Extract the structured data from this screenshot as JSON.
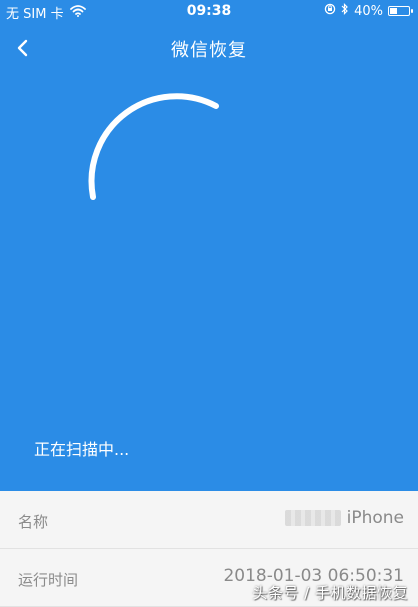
{
  "status_bar": {
    "carrier": "无 SIM 卡",
    "time": "09:38",
    "battery_text": "40%",
    "battery_level": 0.4
  },
  "nav": {
    "title": "微信恢复"
  },
  "scan": {
    "status_text": "正在扫描中..."
  },
  "info": {
    "rows": [
      {
        "label": "名称",
        "value": "iPhone"
      },
      {
        "label": "运行时间",
        "value": "2018-01-03 06:50:31"
      }
    ]
  },
  "watermark": "头条号 / 手机数据恢复",
  "colors": {
    "primary": "#2b8ce6",
    "panel": "#f5f5f5"
  }
}
